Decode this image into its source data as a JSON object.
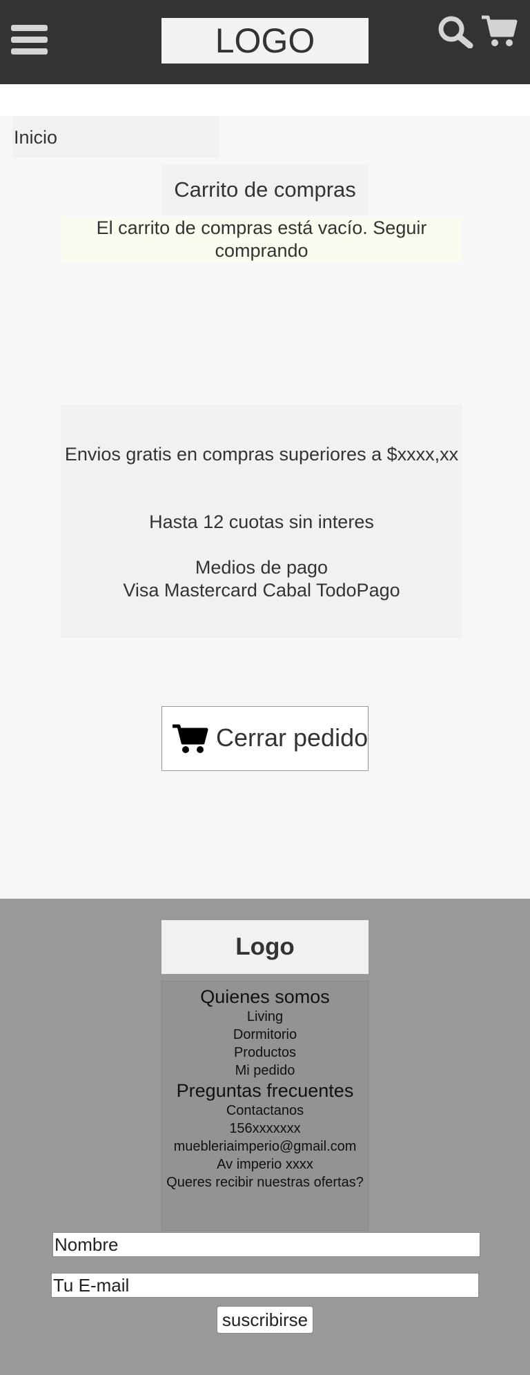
{
  "header": {
    "logo": "LOGO",
    "menu_icon": "hamburger-menu-icon",
    "search_icon": "search-icon",
    "cart_icon": "shopping-cart-icon",
    "background": "#333333"
  },
  "breadcrumb": {
    "home": "Inicio"
  },
  "cart": {
    "title": "Carrito de compras",
    "empty_message": "El carrito de compras está vacío. Seguir comprando"
  },
  "info": {
    "shipping": "Envios gratis en compras superiores a $xxxx,xx",
    "installments": "Hasta 12 cuotas sin interes",
    "payment_title": "Medios de pago",
    "payment_methods": "Visa Mastercard Cabal  TodoPago"
  },
  "checkout": {
    "label": "Cerrar pedido",
    "icon": "shopping-cart-icon"
  },
  "footer": {
    "logo": "Logo",
    "about": "Quienes somos",
    "links": [
      "Living",
      "Dormitorio",
      "Productos",
      "Mi pedido"
    ],
    "faq": "Preguntas frecuentes",
    "contact": "Contactanos",
    "phone": "156xxxxxxx",
    "email": "muebleriaimperio@gmail.com",
    "address": "Av imperio xxxx",
    "newsletter_prompt": "Queres recibir nuestras ofertas?",
    "name_placeholder": "Nombre",
    "email_placeholder": "Tu E-mail",
    "subscribe_label": "suscribirse",
    "background": "#999999"
  }
}
